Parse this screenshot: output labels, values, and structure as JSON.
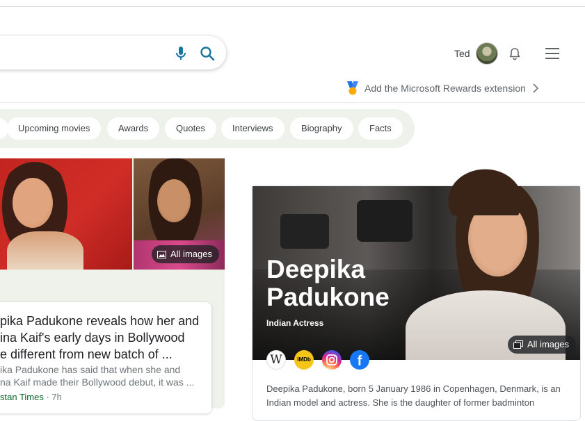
{
  "header": {
    "user_name": "Ted",
    "rewards_text": "Add the Microsoft Rewards extension"
  },
  "chips": [
    "Upcoming movies",
    "Awards",
    "Quotes",
    "Interviews",
    "Biography",
    "Facts"
  ],
  "images": {
    "all_images_label": "All images"
  },
  "news": {
    "title": "pika Padukone reveals how her and\nina Kaif's early days in Bollywood\ne different from new batch of ...",
    "snippet": "ika Padukone has said that when she and\nna Kaif made their Bollywood debut, it was ...",
    "source": "stan Times",
    "time": "· 7h"
  },
  "entity": {
    "name": "Deepika\nPadukone",
    "subtitle": "Indian Actress",
    "all_images_label": "All images",
    "wiki_glyph": "W",
    "imdb_label": "IMDb",
    "fb_glyph": "f",
    "description": "Deepika Padukone, born 5 January 1986 in Copenhagen, Denmark, is an\nIndian model and actress. She is the daughter of former badminton"
  }
}
